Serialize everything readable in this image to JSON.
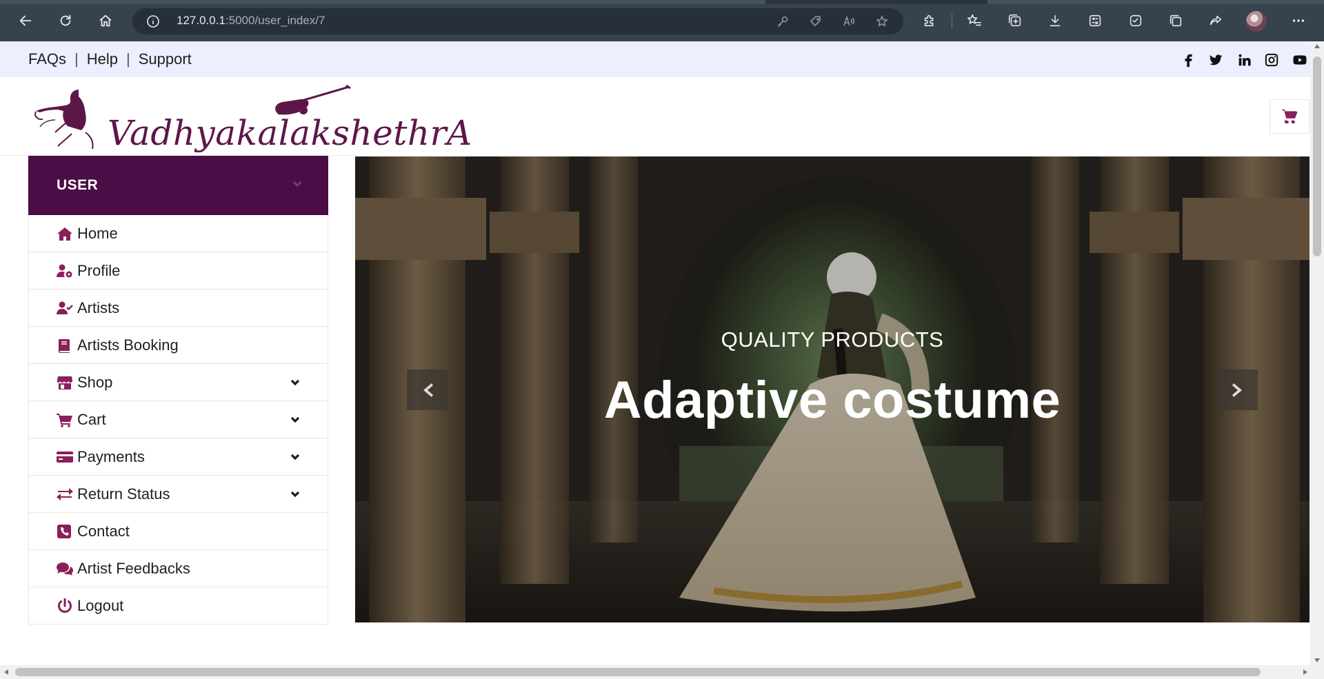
{
  "browser": {
    "url_host": "127.0.0.1",
    "url_rest": ":5000/user_index/7"
  },
  "topbar": {
    "links": [
      "FAQs",
      "Help",
      "Support"
    ],
    "social": [
      "facebook-icon",
      "twitter-icon",
      "linkedin-icon",
      "instagram-icon",
      "youtube-icon"
    ]
  },
  "header": {
    "logo_text": "VadhyakalakshethrA",
    "cart_icon": "cart-icon"
  },
  "sidebar": {
    "title": "USER",
    "items": [
      {
        "label": "Home",
        "icon": "home-icon",
        "dropdown": false
      },
      {
        "label": "Profile",
        "icon": "user-gear-icon",
        "dropdown": false
      },
      {
        "label": "Artists",
        "icon": "user-check-icon",
        "dropdown": false
      },
      {
        "label": "Artists Booking",
        "icon": "book-icon",
        "dropdown": false
      },
      {
        "label": "Shop",
        "icon": "store-icon",
        "dropdown": true
      },
      {
        "label": "Cart",
        "icon": "cart-icon",
        "dropdown": true
      },
      {
        "label": "Payments",
        "icon": "credit-card-icon",
        "dropdown": true
      },
      {
        "label": "Return Status",
        "icon": "exchange-icon",
        "dropdown": true
      },
      {
        "label": "Contact",
        "icon": "phone-icon",
        "dropdown": false
      },
      {
        "label": "Artist Feedbacks",
        "icon": "comments-icon",
        "dropdown": false
      },
      {
        "label": "Logout",
        "icon": "power-icon",
        "dropdown": false
      }
    ]
  },
  "hero": {
    "kicker": "QUALITY PRODUCTS",
    "headline": "Adaptive costume"
  },
  "colors": {
    "accent": "#8b1e5c",
    "sidebar_head": "#4a0d45",
    "topbar_bg": "#ebeffe",
    "browser_bar": "#36424e"
  }
}
